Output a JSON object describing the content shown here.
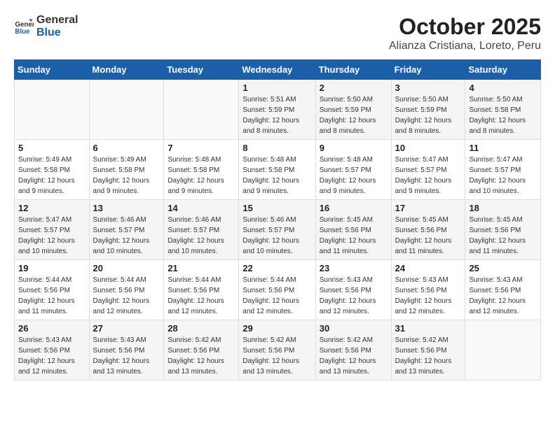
{
  "header": {
    "logo_general": "General",
    "logo_blue": "Blue",
    "month": "October 2025",
    "location": "Alianza Cristiana, Loreto, Peru"
  },
  "weekdays": [
    "Sunday",
    "Monday",
    "Tuesday",
    "Wednesday",
    "Thursday",
    "Friday",
    "Saturday"
  ],
  "weeks": [
    [
      null,
      null,
      null,
      {
        "day": 1,
        "sunrise": "5:51 AM",
        "sunset": "5:59 PM",
        "daylight": "12 hours and 8 minutes."
      },
      {
        "day": 2,
        "sunrise": "5:50 AM",
        "sunset": "5:59 PM",
        "daylight": "12 hours and 8 minutes."
      },
      {
        "day": 3,
        "sunrise": "5:50 AM",
        "sunset": "5:59 PM",
        "daylight": "12 hours and 8 minutes."
      },
      {
        "day": 4,
        "sunrise": "5:50 AM",
        "sunset": "5:58 PM",
        "daylight": "12 hours and 8 minutes."
      }
    ],
    [
      {
        "day": 5,
        "sunrise": "5:49 AM",
        "sunset": "5:58 PM",
        "daylight": "12 hours and 9 minutes."
      },
      {
        "day": 6,
        "sunrise": "5:49 AM",
        "sunset": "5:58 PM",
        "daylight": "12 hours and 9 minutes."
      },
      {
        "day": 7,
        "sunrise": "5:48 AM",
        "sunset": "5:58 PM",
        "daylight": "12 hours and 9 minutes."
      },
      {
        "day": 8,
        "sunrise": "5:48 AM",
        "sunset": "5:58 PM",
        "daylight": "12 hours and 9 minutes."
      },
      {
        "day": 9,
        "sunrise": "5:48 AM",
        "sunset": "5:57 PM",
        "daylight": "12 hours and 9 minutes."
      },
      {
        "day": 10,
        "sunrise": "5:47 AM",
        "sunset": "5:57 PM",
        "daylight": "12 hours and 9 minutes."
      },
      {
        "day": 11,
        "sunrise": "5:47 AM",
        "sunset": "5:57 PM",
        "daylight": "12 hours and 10 minutes."
      }
    ],
    [
      {
        "day": 12,
        "sunrise": "5:47 AM",
        "sunset": "5:57 PM",
        "daylight": "12 hours and 10 minutes."
      },
      {
        "day": 13,
        "sunrise": "5:46 AM",
        "sunset": "5:57 PM",
        "daylight": "12 hours and 10 minutes."
      },
      {
        "day": 14,
        "sunrise": "5:46 AM",
        "sunset": "5:57 PM",
        "daylight": "12 hours and 10 minutes."
      },
      {
        "day": 15,
        "sunrise": "5:46 AM",
        "sunset": "5:57 PM",
        "daylight": "12 hours and 10 minutes."
      },
      {
        "day": 16,
        "sunrise": "5:45 AM",
        "sunset": "5:56 PM",
        "daylight": "12 hours and 11 minutes."
      },
      {
        "day": 17,
        "sunrise": "5:45 AM",
        "sunset": "5:56 PM",
        "daylight": "12 hours and 11 minutes."
      },
      {
        "day": 18,
        "sunrise": "5:45 AM",
        "sunset": "5:56 PM",
        "daylight": "12 hours and 11 minutes."
      }
    ],
    [
      {
        "day": 19,
        "sunrise": "5:44 AM",
        "sunset": "5:56 PM",
        "daylight": "12 hours and 11 minutes."
      },
      {
        "day": 20,
        "sunrise": "5:44 AM",
        "sunset": "5:56 PM",
        "daylight": "12 hours and 12 minutes."
      },
      {
        "day": 21,
        "sunrise": "5:44 AM",
        "sunset": "5:56 PM",
        "daylight": "12 hours and 12 minutes."
      },
      {
        "day": 22,
        "sunrise": "5:44 AM",
        "sunset": "5:56 PM",
        "daylight": "12 hours and 12 minutes."
      },
      {
        "day": 23,
        "sunrise": "5:43 AM",
        "sunset": "5:56 PM",
        "daylight": "12 hours and 12 minutes."
      },
      {
        "day": 24,
        "sunrise": "5:43 AM",
        "sunset": "5:56 PM",
        "daylight": "12 hours and 12 minutes."
      },
      {
        "day": 25,
        "sunrise": "5:43 AM",
        "sunset": "5:56 PM",
        "daylight": "12 hours and 12 minutes."
      }
    ],
    [
      {
        "day": 26,
        "sunrise": "5:43 AM",
        "sunset": "5:56 PM",
        "daylight": "12 hours and 12 minutes."
      },
      {
        "day": 27,
        "sunrise": "5:43 AM",
        "sunset": "5:56 PM",
        "daylight": "12 hours and 13 minutes."
      },
      {
        "day": 28,
        "sunrise": "5:42 AM",
        "sunset": "5:56 PM",
        "daylight": "12 hours and 13 minutes."
      },
      {
        "day": 29,
        "sunrise": "5:42 AM",
        "sunset": "5:56 PM",
        "daylight": "12 hours and 13 minutes."
      },
      {
        "day": 30,
        "sunrise": "5:42 AM",
        "sunset": "5:56 PM",
        "daylight": "12 hours and 13 minutes."
      },
      {
        "day": 31,
        "sunrise": "5:42 AM",
        "sunset": "5:56 PM",
        "daylight": "12 hours and 13 minutes."
      },
      null
    ]
  ],
  "daylight_label": "Daylight hours",
  "sunrise_label": "Sunrise:",
  "sunset_label": "Sunset:"
}
